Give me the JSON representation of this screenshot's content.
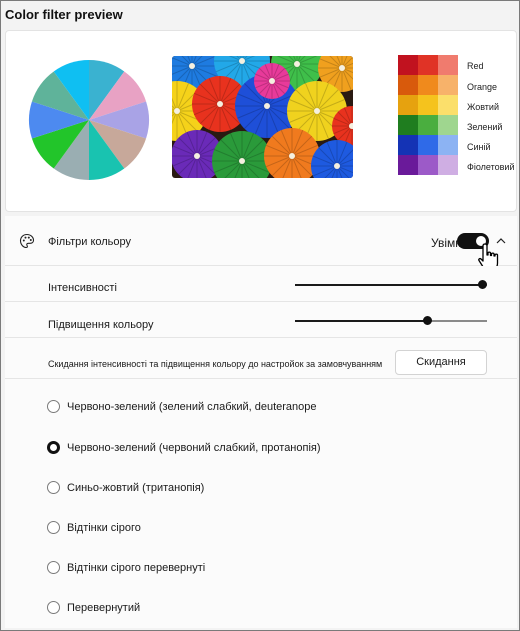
{
  "title": "Color filter preview",
  "swatches": [
    {
      "label": "Red",
      "colors": [
        "#c1121f",
        "#e03326",
        "#f07b6e"
      ]
    },
    {
      "label": "Orange",
      "colors": [
        "#d85a0c",
        "#f08a1c",
        "#f7b26a"
      ]
    },
    {
      "label": "Жовтий",
      "colors": [
        "#e6a20f",
        "#f5c31d",
        "#fbdf6b"
      ]
    },
    {
      "label": "Зелений",
      "colors": [
        "#1f7d1f",
        "#4aae3f",
        "#9fd68f"
      ]
    },
    {
      "label": "Синій",
      "colors": [
        "#1433b5",
        "#2f6ae8",
        "#8cb3f3"
      ]
    },
    {
      "label": "Фіолетовий",
      "colors": [
        "#6a1a9a",
        "#9c5ac8",
        "#cfaee3"
      ]
    }
  ],
  "pie_colors": [
    "#3ab2d0",
    "#e8a2c4",
    "#a9a3e6",
    "#c7a89a",
    "#19c3b0",
    "#9aaeb2",
    "#22c52a",
    "#4d8af0",
    "#5fb39a",
    "#0fbff2"
  ],
  "filters": {
    "label": "Фільтри кольору",
    "toggle_label": "Увімк",
    "toggle_on": true
  },
  "intensity": {
    "label": "Інтенсивності",
    "value": 1.0
  },
  "boost": {
    "label": "Підвищення кольору",
    "value": 0.7
  },
  "reset": {
    "text": "Скидання інтенсивності та підвищення кольору до настройок за замовчуванням",
    "button": "Скидання"
  },
  "radios": [
    {
      "label": "Червоно-зелений (зелений слабкий, deuteranope",
      "selected": false
    },
    {
      "label": "Червоно-зелений (червоний слабкий, протанопія)",
      "selected": true
    },
    {
      "label": "Синьо-жовтий (тританопія)",
      "selected": false
    },
    {
      "label": "Відтінки сірого",
      "selected": false
    },
    {
      "label": "Відтінки сірого перевернуті",
      "selected": false
    },
    {
      "label": "Перевернутий",
      "selected": false
    }
  ]
}
